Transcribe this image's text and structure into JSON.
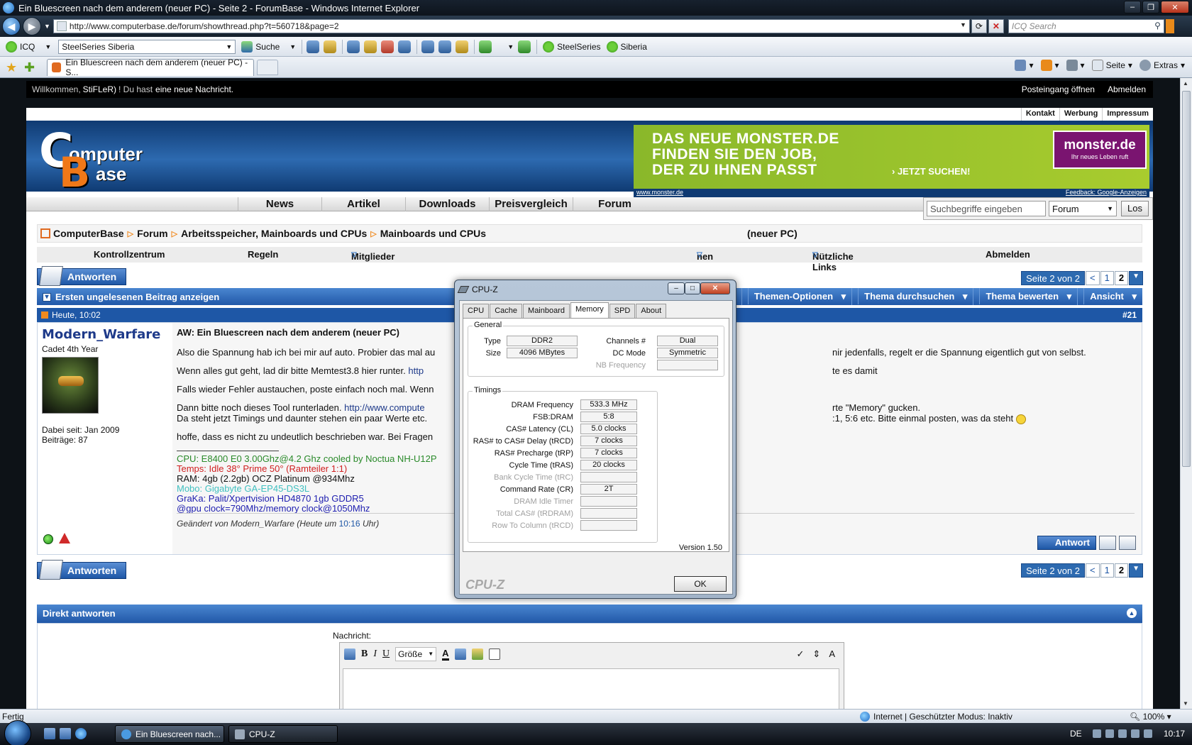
{
  "window": {
    "title": "Ein Bluescreen nach dem anderem (neuer PC) - Seite 2 - ForumBase - Windows Internet Explorer",
    "minimize": "–",
    "maximize": "❐",
    "close": "✕"
  },
  "address": {
    "url": "http://www.computerbase.de/forum/showthread.php?t=560718&page=2",
    "search_placeholder": "ICQ Search"
  },
  "toolbar": {
    "icq": "ICQ",
    "select_value": "SteelSeries Siberia",
    "search_label": "Suche",
    "link1": "SteelSeries",
    "link2": "Siberia"
  },
  "tabs": {
    "active_title": "Ein Bluescreen nach dem anderem (neuer PC) - S...",
    "page_menu": "Seite",
    "extras_menu": "Extras"
  },
  "welcome": {
    "prefix": "Willkommen,",
    "user": "StiFLeR)",
    "mid": "! Du hast",
    "message": "eine neue Nachricht.",
    "inbox": "Posteingang öffnen",
    "logout": "Abmelden"
  },
  "toplinks": [
    "Kontakt",
    "Werbung",
    "Impressum"
  ],
  "logo": {
    "c": "C",
    "b": "B",
    "t1": "omputer",
    "t2": "ase"
  },
  "ad": {
    "line1": "DAS NEUE MONSTER.DE",
    "line2": "FINDEN SIE DEN JOB,",
    "line3": "DER ZU IHNEN PASST",
    "cta": "› JETZT SUCHEN!",
    "brand": "monster.de",
    "brand_slogan": "Ihr neues Leben ruft",
    "footer_left": "www.monster.de",
    "footer_right": "Feedback: Google-Anzeigen"
  },
  "mainnav": [
    "News",
    "Artikel",
    "Downloads",
    "Preisvergleich",
    "Forum"
  ],
  "forum_search": {
    "placeholder": "Suchbegriffe eingeben",
    "scope": "Forum",
    "button": "Los"
  },
  "breadcrumb": [
    "ComputerBase",
    "Forum",
    "Arbeitsspeicher, Mainboards und CPUs",
    "Mainboards und CPUs"
  ],
  "breadcrumb_tail": "(neuer PC)",
  "usernav": {
    "control": "Kontrollzentrum",
    "rules": "Regeln",
    "members": "Mitglieder",
    "partial": "nen",
    "links": "Nützliche Links",
    "logout": "Abmelden"
  },
  "reply_label": "Antworten",
  "pager": {
    "label": "Seite 2 von 2",
    "prev": "<",
    "p1": "1",
    "p2": "2"
  },
  "threadbar": {
    "first_unread": "Ersten ungelesenen Beitrag anzeigen",
    "options": [
      "Themen-Optionen",
      "Thema durchsuchen",
      "Thema bewerten",
      "Ansicht"
    ]
  },
  "post": {
    "date": "Heute, 10:02",
    "number": "#21",
    "username": "Modern_Warfare",
    "user_title": "Cadet 4th Year",
    "joined": "Dabei seit: Jan 2009",
    "post_count": "Beiträge: 87",
    "title": "AW: Ein Bluescreen nach dem anderem (neuer PC)",
    "line1a": "Also die Spannung hab ich bei mir auf auto. Probier das mal au",
    "line1b": "nir jedenfalls, regelt er die Spannung eigentlich gut von selbst.",
    "line2a": "Wenn alles gut geht, lad dir bitte Memtest3.8 hier runter.",
    "line2link": "http",
    "line2b": "te es damit",
    "line3a": "Falls wieder Fehler austauchen, poste einfach noch mal. Wenn",
    "line4a": "Dann bitte noch dieses Tool runterladen.",
    "line4link": "http://www.compute",
    "line4b": "rte \"Memory\" gucken.",
    "line5a": "Da steht jetzt Timings und daunter stehen ein paar Werte etc.",
    "line5b": ":1, 5:6 etc. Bitte einmal posten, was da steht",
    "line6a": "hoffe, dass es nicht zu undeutlich beschrieben war. Bei Fragen",
    "sig": [
      {
        "text": "CPU: E8400 E0 3.00Ghz@4.2 Ghz cooled by Noctua NH-U12P",
        "color": "#2a8a2a"
      },
      {
        "text": "Temps: Idle 38° Prime 50° (Ramteiler 1:1)",
        "color": "#d02020"
      },
      {
        "text": "RAM: 4gb (2.2gb) OCZ Platinum @934Mhz",
        "color": "#111111"
      },
      {
        "text": "Mobo: Gigabyte GA-EP45-DS3L",
        "color": "#40c0c0"
      },
      {
        "text": "GraKa: Palit/Xpertvision HD4870 1gb GDDR5",
        "color": "#2020b0"
      },
      {
        "text": "@gpu clock=790Mhz/memory clock@1050Mhz",
        "color": "#2020b0"
      }
    ],
    "edited_prefix": "Geändert von Modern_Warfare (Heute um",
    "edited_time": "10:16",
    "edited_suffix": "Uhr)",
    "answer_btn": "Antwort"
  },
  "quick_reply": {
    "title": "Direkt antworten",
    "message_label": "Nachricht:",
    "size_label": "Größe"
  },
  "cpuz": {
    "title": "CPU-Z",
    "tabs": [
      "CPU",
      "Cache",
      "Mainboard",
      "Memory",
      "SPD",
      "About"
    ],
    "general_title": "General",
    "type_label": "Type",
    "type": "DDR2",
    "size_label": "Size",
    "size": "4096 MBytes",
    "channels_label": "Channels #",
    "channels": "Dual",
    "dcmode_label": "DC Mode",
    "dcmode": "Symmetric",
    "nbfreq_label": "NB Frequency",
    "timings_title": "Timings",
    "timings": [
      {
        "label": "DRAM Frequency",
        "value": "533.3 MHz",
        "disabled": false
      },
      {
        "label": "FSB:DRAM",
        "value": "5:8",
        "disabled": false
      },
      {
        "label": "CAS# Latency (CL)",
        "value": "5.0 clocks",
        "disabled": false
      },
      {
        "label": "RAS# to CAS# Delay (tRCD)",
        "value": "7 clocks",
        "disabled": false
      },
      {
        "label": "RAS# Precharge (tRP)",
        "value": "7 clocks",
        "disabled": false
      },
      {
        "label": "Cycle Time (tRAS)",
        "value": "20 clocks",
        "disabled": false
      },
      {
        "label": "Bank Cycle Time (tRC)",
        "value": "",
        "disabled": true
      },
      {
        "label": "Command Rate (CR)",
        "value": "2T",
        "disabled": false
      },
      {
        "label": "DRAM Idle Timer",
        "value": "",
        "disabled": true
      },
      {
        "label": "Total CAS# (tRDRAM)",
        "value": "",
        "disabled": true
      },
      {
        "label": "Row To Column (tRCD)",
        "value": "",
        "disabled": true
      }
    ],
    "version": "Version 1.50",
    "brand": "CPU-Z",
    "ok": "OK"
  },
  "status": {
    "left": "Fertig",
    "zone": "Internet | Geschützter Modus: Inaktiv",
    "zoom": "100%"
  },
  "taskbar": {
    "task1": "Ein Bluescreen nach...",
    "task2": "CPU-Z",
    "lang": "DE",
    "clock": "10:17"
  }
}
